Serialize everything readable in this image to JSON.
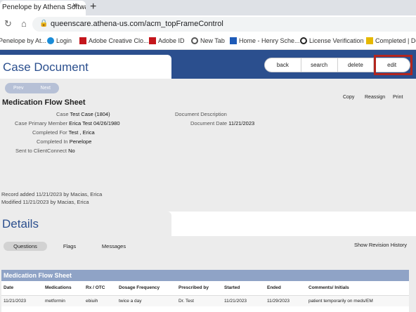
{
  "browser": {
    "tab_title": "Penelope by Athena Softwa",
    "tab_close": "×",
    "new_tab": "+",
    "url": "queenscare.athena-us.com/acm_topFrameControl",
    "bookmarks": [
      {
        "label": "Penelope by At...",
        "color": "#ffffff"
      },
      {
        "label": "Login",
        "color": "#1a8cd8"
      },
      {
        "label": "Adobe Creative Clo...",
        "color": "#c4161c"
      },
      {
        "label": "Adobe ID",
        "color": "#c4161c"
      },
      {
        "label": "New Tab",
        "color": "#555555"
      },
      {
        "label": "Home - Henry Sche...",
        "color": "#1e5bb8"
      },
      {
        "label": "License Verification",
        "color": "#222222"
      },
      {
        "label": "Completed | Doc",
        "color": "#e6b800"
      }
    ]
  },
  "header": {
    "title": "Case Document",
    "buttons": {
      "back": "back",
      "search": "search",
      "delete": "delete",
      "edit": "edit"
    }
  },
  "document": {
    "pager": {
      "prev": "Prev",
      "next": "Next"
    },
    "title": "Medication Flow Sheet",
    "actions": {
      "copy": "Copy",
      "reassign": "Reassign",
      "print": "Print"
    },
    "fields": {
      "case_label": "Case",
      "case_value": "Test Case (1804)",
      "primary_label": "Case Primary Member",
      "primary_value": "Erica Test 04/26/1980",
      "completed_for_label": "Completed For",
      "completed_for_value": "Test , Erica",
      "completed_in_label": "Completed In",
      "completed_in_value": "Penelope",
      "sent_label": "Sent to ClientConnect",
      "sent_value": "No",
      "desc_label": "Document Description",
      "date_label": "Document Date",
      "date_value": "11/21/2023"
    },
    "record_added": "Record added 11/21/2023 by Macias, Erica",
    "modified": "Modified 11/21/2023 by Macias, Erica"
  },
  "details": {
    "title": "Details",
    "tabs": {
      "questions": "Questions",
      "flags": "Flags",
      "messages": "Messages"
    },
    "revision_history": "Show Revision History",
    "grid": {
      "title": "Medication Flow Sheet",
      "columns": {
        "date": "Date",
        "medications": "Medications",
        "rx": "Rx / OTC",
        "dosage": "Dosage Frequency",
        "prescribed": "Prescribed by",
        "started": "Started",
        "ended": "Ended",
        "comments": "Comments/ Initials"
      },
      "row": {
        "date": "11/21/2023",
        "medications": "metformin",
        "rx": "ebiuih",
        "dosage": "twice a day",
        "prescribed": "Dr. Test",
        "started": "11/21/2023",
        "ended": "11/29/2023",
        "comments": "patient temporarily on meds/EM"
      }
    }
  }
}
